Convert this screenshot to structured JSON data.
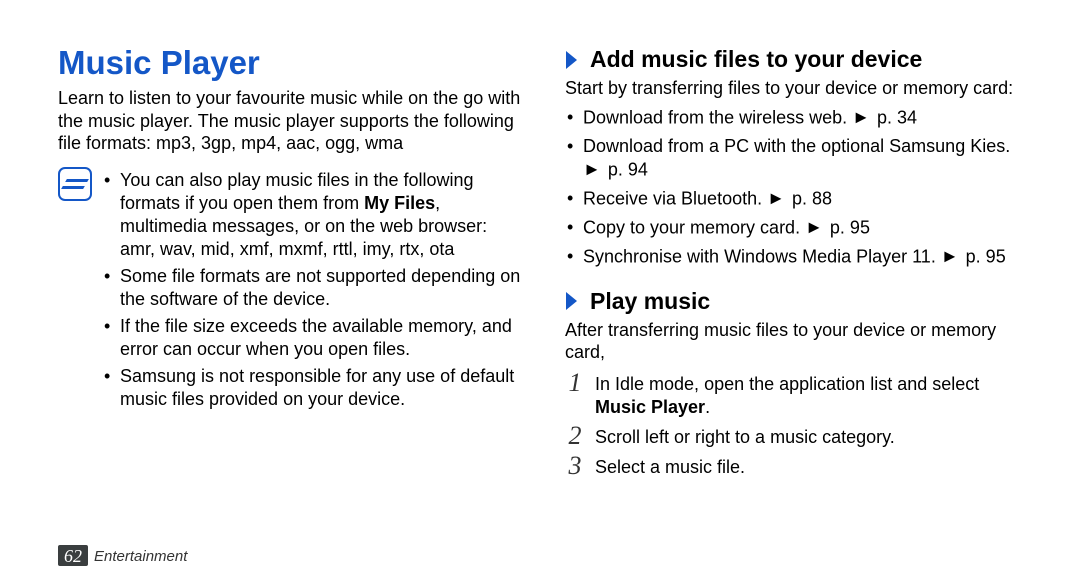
{
  "left": {
    "title": "Music Player",
    "intro": "Learn to listen to your favourite music while on the go with the music player. The music player supports the following file formats: mp3, 3gp, mp4, aac, ogg, wma",
    "note_bullets": [
      {
        "pre": "You can also play music files in the following formats if you open them from ",
        "bold": "My Files",
        "post": ", multimedia messages, or on the web browser: amr, wav, mid, xmf, mxmf, rttl, imy, rtx, ota"
      },
      {
        "text": "Some file formats are not supported depending on the software of the device."
      },
      {
        "text": "If the file size exceeds the available memory, and error can occur when you open files."
      },
      {
        "text": "Samsung is not responsible for any use of default music files provided on your device."
      }
    ]
  },
  "right": {
    "section1": {
      "heading": "Add music files to your device",
      "intro": "Start by transferring files to your device or memory card:",
      "bullets": [
        {
          "text": "Download from the wireless web. ",
          "ref": "p. 34"
        },
        {
          "text": "Download from a PC with the optional Samsung Kies. ",
          "ref": "p. 94"
        },
        {
          "text": "Receive via Bluetooth. ",
          "ref": "p. 88"
        },
        {
          "text": "Copy to your memory card. ",
          "ref": "p. 95"
        },
        {
          "text": "Synchronise with Windows Media Player 11. ",
          "ref": "p. 95"
        }
      ]
    },
    "section2": {
      "heading": "Play music",
      "intro": "After transferring music files to your device or memory card,",
      "steps": [
        {
          "n": "1",
          "pre": "In Idle mode, open the application list and select ",
          "bold": "Music Player",
          "post": "."
        },
        {
          "n": "2",
          "text": "Scroll left or right to a music category."
        },
        {
          "n": "3",
          "text": "Select a music file."
        }
      ]
    }
  },
  "footer": {
    "page": "62",
    "section": "Entertainment"
  },
  "glyph": {
    "tri": "►"
  }
}
